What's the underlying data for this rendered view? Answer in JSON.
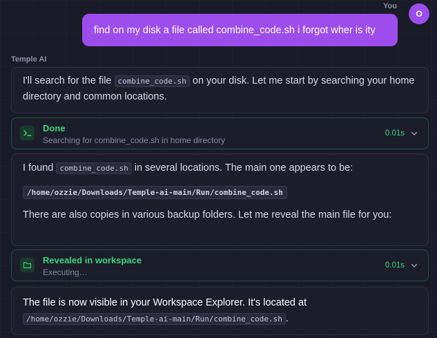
{
  "user": {
    "label": "You",
    "avatar_initial": "O",
    "message": "find on my disk a file called combine_code.sh i forgot wher is ity"
  },
  "assistant": {
    "label": "Temple AI",
    "msg1": {
      "before": "I'll search for the file ",
      "code": "combine_code.sh",
      "after_line1": " on your disk. Let me start by searching your home",
      "line2": "directory and common locations."
    },
    "tool1": {
      "title": "Done",
      "subtitle": "Searching for combine_code.sh in home directory",
      "time": "0.01s",
      "icon": "terminal-icon"
    },
    "msg2": {
      "before": "I found ",
      "code": "combine_code.sh",
      "after": " in several locations. The main one appears to be:",
      "path": "/home/ozzie/Downloads/Temple-ai-main/Run/combine_code.sh",
      "footer": "There are also copies in various backup folders. Let me reveal the main file for you:"
    },
    "tool2": {
      "title": "Revealed in workspace",
      "subtitle": "Executing…",
      "time": "0.01s",
      "icon": "folder-icon"
    },
    "msg3": {
      "line1": "The file is now visible in your Workspace Explorer. It's located at",
      "path": "/home/ozzie/Downloads/Temple-ai-main/Run/combine_code.sh",
      "period": "."
    }
  },
  "colors": {
    "accent_purple": "#9d4dec",
    "success_green": "#3fd27c",
    "background": "#1a1b29"
  }
}
